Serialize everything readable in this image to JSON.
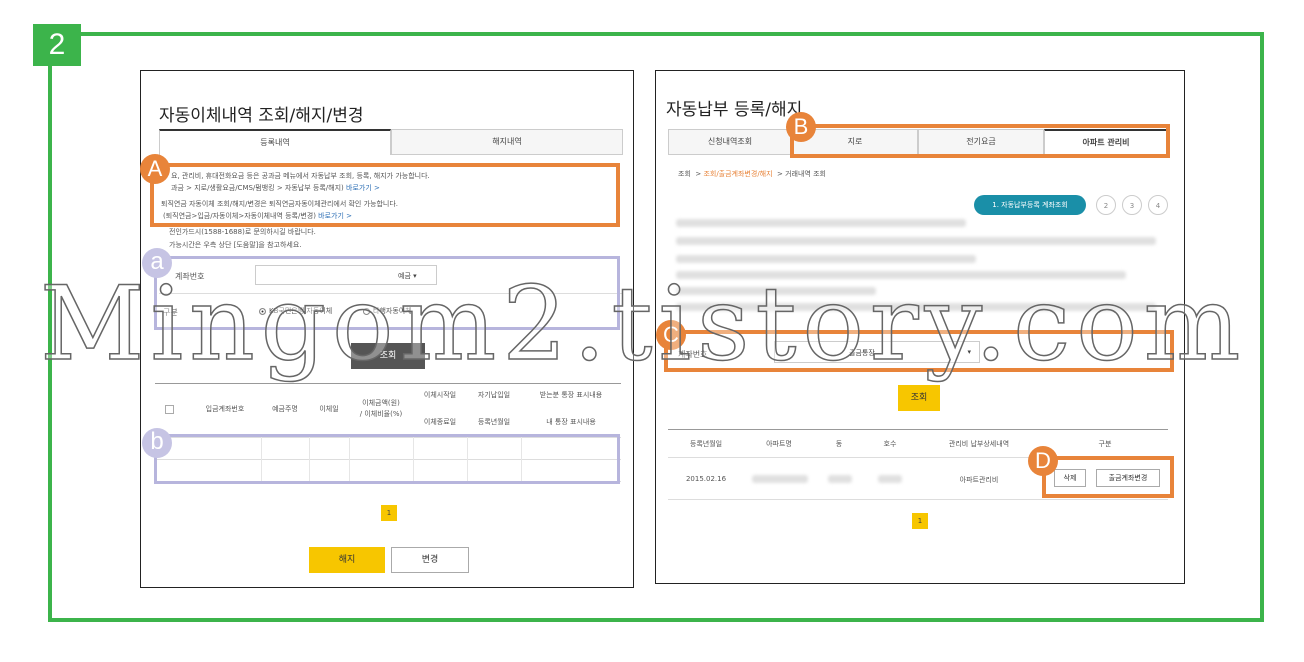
{
  "step_badge": "2",
  "left_panel": {
    "title": "자동이체내역 조회/해지/변경",
    "tabs": [
      "등록내역",
      "해지내역"
    ],
    "info_lines": [
      "요, 관리비, 휴대전화요금 등은 공과금 메뉴에서 자동납부 조회, 등록, 해지가 가능합니다.",
      "과금 > 지로/생활요금/CMS/펌뱅킹 > 자동납부 등록/해지)",
      "퇴직연금 자동이체 조회/해지/변경은 퇴직연금자동이체관리에서 확인 가능합니다.",
      "(퇴직연금>입금/자동이체>자동이체내역 등록/변경)",
      "전인가드시(1588-1688)로 문의하시길 바랍니다.",
      "가능시간은 우측 상단 [도움말]을 참고하세요."
    ],
    "shortcut_label": "바로가기 >",
    "account_label": "계좌번호",
    "account_select": "예금",
    "type_label": "구분",
    "radio_options": [
      "KB국민은행 자동이체",
      "타행자동이체"
    ],
    "search_button": "조회",
    "table_headers": [
      "입금계좌번호",
      "예금주명",
      "이체일",
      "이체금액(원)",
      "/ 이체비율(%)",
      "이체시작일",
      "이체종료일",
      "자기납입일",
      "등록년월일",
      "받는분 통장 표시내용",
      "내 통장 표시내용"
    ],
    "page": "1",
    "cancel_button": "해지",
    "change_button": "변경"
  },
  "right_panel": {
    "title": "자동납부 등록/해지",
    "tabs": [
      "신청내역조회",
      "지로",
      "전기요금",
      "아파트 관리비"
    ],
    "breadcrumb": [
      "조회",
      "조회/출금계좌변경/해지",
      "거래내역 조회"
    ],
    "step_button": "1. 자동납부등록 계좌조회",
    "step_numbers": [
      "2",
      "3",
      "4"
    ],
    "account_label": "계좌번호",
    "account_select": "출금통장",
    "search_button": "조회",
    "table_headers": [
      "등록년월일",
      "아파트명",
      "동",
      "호수",
      "관리비 납부상세내역",
      "구분"
    ],
    "row": {
      "date": "2015.02.16",
      "detail": "아파트관리비"
    },
    "delete_button": "삭제",
    "change_account_button": "출금계좌변경",
    "page": "1"
  },
  "markers": {
    "A": "A",
    "B": "B",
    "C": "C",
    "D": "D",
    "a": "a",
    "b": "b"
  },
  "watermark": "Mingom2.tistory.com",
  "colors": {
    "green": "#3cb44b",
    "orange": "#e8843a",
    "purple": "#b7b5dd",
    "yellow": "#f7c600",
    "teal": "#1a8fa8"
  }
}
